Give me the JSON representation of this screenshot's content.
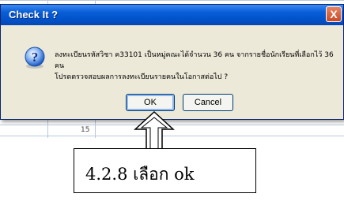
{
  "background_sheet": {
    "visible_number": "15"
  },
  "dialog": {
    "title": "Check It ?",
    "close_glyph": "X",
    "icon": "question-icon",
    "message_line1": "ลงทะเบียนรหัสวิชา ค33101 เป็นหมู่คณะได้จำนวน 36 คน  จากรายชื่อนักเรียนที่เลือกไว้ 36 คน",
    "message_line2": "โปรดตรวจสอบผลการลงทะเบียนรายคนในโอกาสต่อไป ?",
    "ok_label": "OK",
    "cancel_label": "Cancel"
  },
  "callout": {
    "arrow": "up-arrow-icon",
    "text": "4.2.8  เลือก  ok"
  }
}
